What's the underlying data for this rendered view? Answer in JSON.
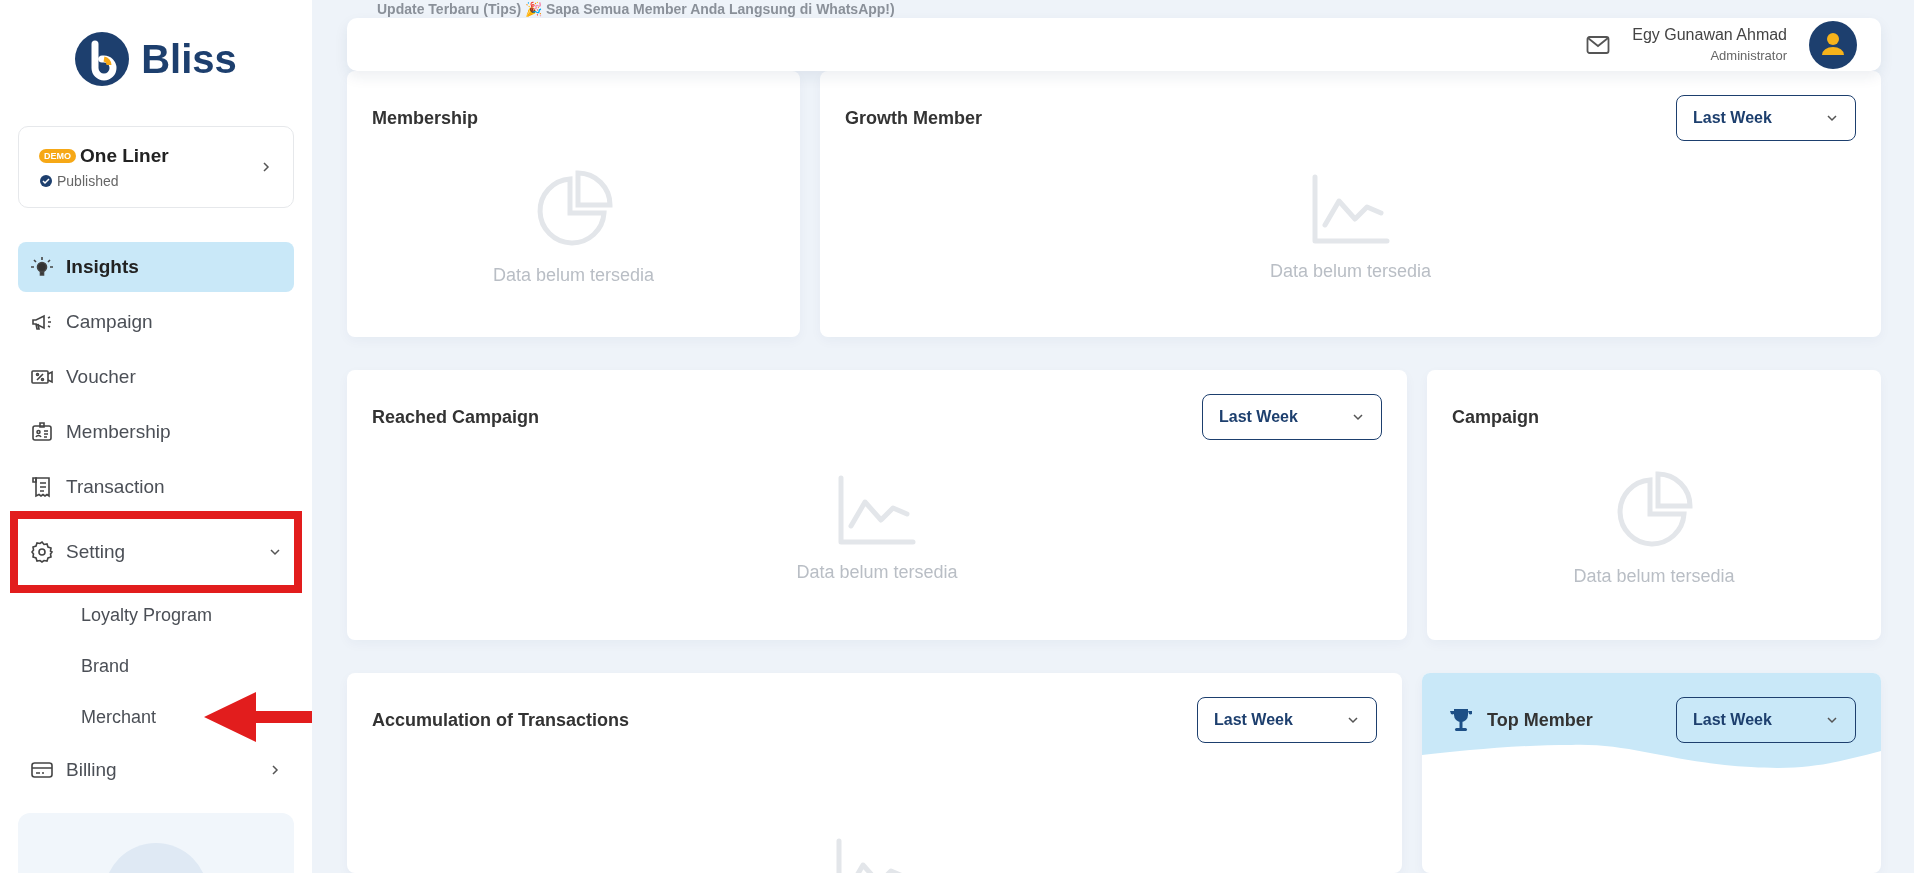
{
  "banner": {
    "text": "Update Terbaru (Tips) 🎉 Sapa Semua Member Anda Langsung di WhatsApp!)"
  },
  "brand": {
    "name": "Bliss"
  },
  "project": {
    "badge": "DEMO",
    "name": "One Liner",
    "status": "Published"
  },
  "nav": [
    {
      "label": "Insights",
      "selected": true
    },
    {
      "label": "Campaign",
      "selected": false
    },
    {
      "label": "Voucher",
      "selected": false
    },
    {
      "label": "Membership",
      "selected": false
    },
    {
      "label": "Transaction",
      "selected": false
    },
    {
      "label": "Setting",
      "selected": false,
      "expanded": true,
      "highlighted": true,
      "children": [
        {
          "label": "Loyalty Program",
          "selected": false,
          "pointed": false
        },
        {
          "label": "Brand",
          "selected": false,
          "pointed": false
        },
        {
          "label": "Merchant",
          "selected": false,
          "pointed": true
        }
      ]
    },
    {
      "label": "Billing",
      "selected": false,
      "expanded": false
    }
  ],
  "header": {
    "user_name": "Egy Gunawan Ahmad",
    "role": "Administrator"
  },
  "rows": [
    [
      {
        "kind": "pie",
        "title": "Membership",
        "empty_text": "Data belum tersedia"
      },
      {
        "kind": "line",
        "title": "Growth Member",
        "period": "Last Week",
        "empty_text": "Data belum tersedia"
      }
    ],
    [
      {
        "kind": "line",
        "title": "Reached Campaign",
        "period": "Last Week",
        "empty_text": "Data belum tersedia"
      },
      {
        "kind": "pie",
        "title": "Campaign",
        "empty_text": "Data belum tersedia"
      }
    ],
    [
      {
        "kind": "line",
        "title": "Accumulation of Transactions",
        "period": "Last Week"
      },
      {
        "kind": "ranking",
        "title": "Top Member",
        "period": "Last Week"
      }
    ]
  ]
}
